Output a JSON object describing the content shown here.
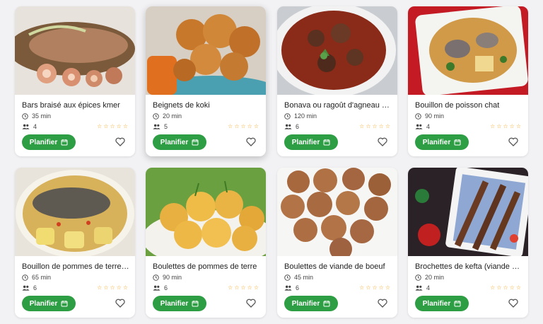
{
  "recipes": [
    {
      "title": "Bars braisé aux épices kmer",
      "time": "35 min",
      "servings": "4",
      "plan_label": "Planifier"
    },
    {
      "title": "Beignets de koki",
      "time": "20 min",
      "servings": "5",
      "plan_label": "Planifier"
    },
    {
      "title": "Bonava ou ragoût d'agneau m...",
      "time": "120 min",
      "servings": "6",
      "plan_label": "Planifier"
    },
    {
      "title": "Bouillon de poisson chat",
      "time": "90 min",
      "servings": "4",
      "plan_label": "Planifier"
    },
    {
      "title": "Bouillon de pommes de terre ...",
      "time": "65 min",
      "servings": "6",
      "plan_label": "Planifier"
    },
    {
      "title": "Boulettes de pommes de terre",
      "time": "90 min",
      "servings": "6",
      "plan_label": "Planifier"
    },
    {
      "title": "Boulettes de viande de boeuf",
      "time": "45 min",
      "servings": "6",
      "plan_label": "Planifier"
    },
    {
      "title": "Brochettes de kefta (viande h...",
      "time": "20 min",
      "servings": "4",
      "plan_label": "Planifier"
    }
  ],
  "rating_stars": 5,
  "colors": {
    "accent": "#2e9e44",
    "star": "#f5a623",
    "heart": "#555555"
  }
}
